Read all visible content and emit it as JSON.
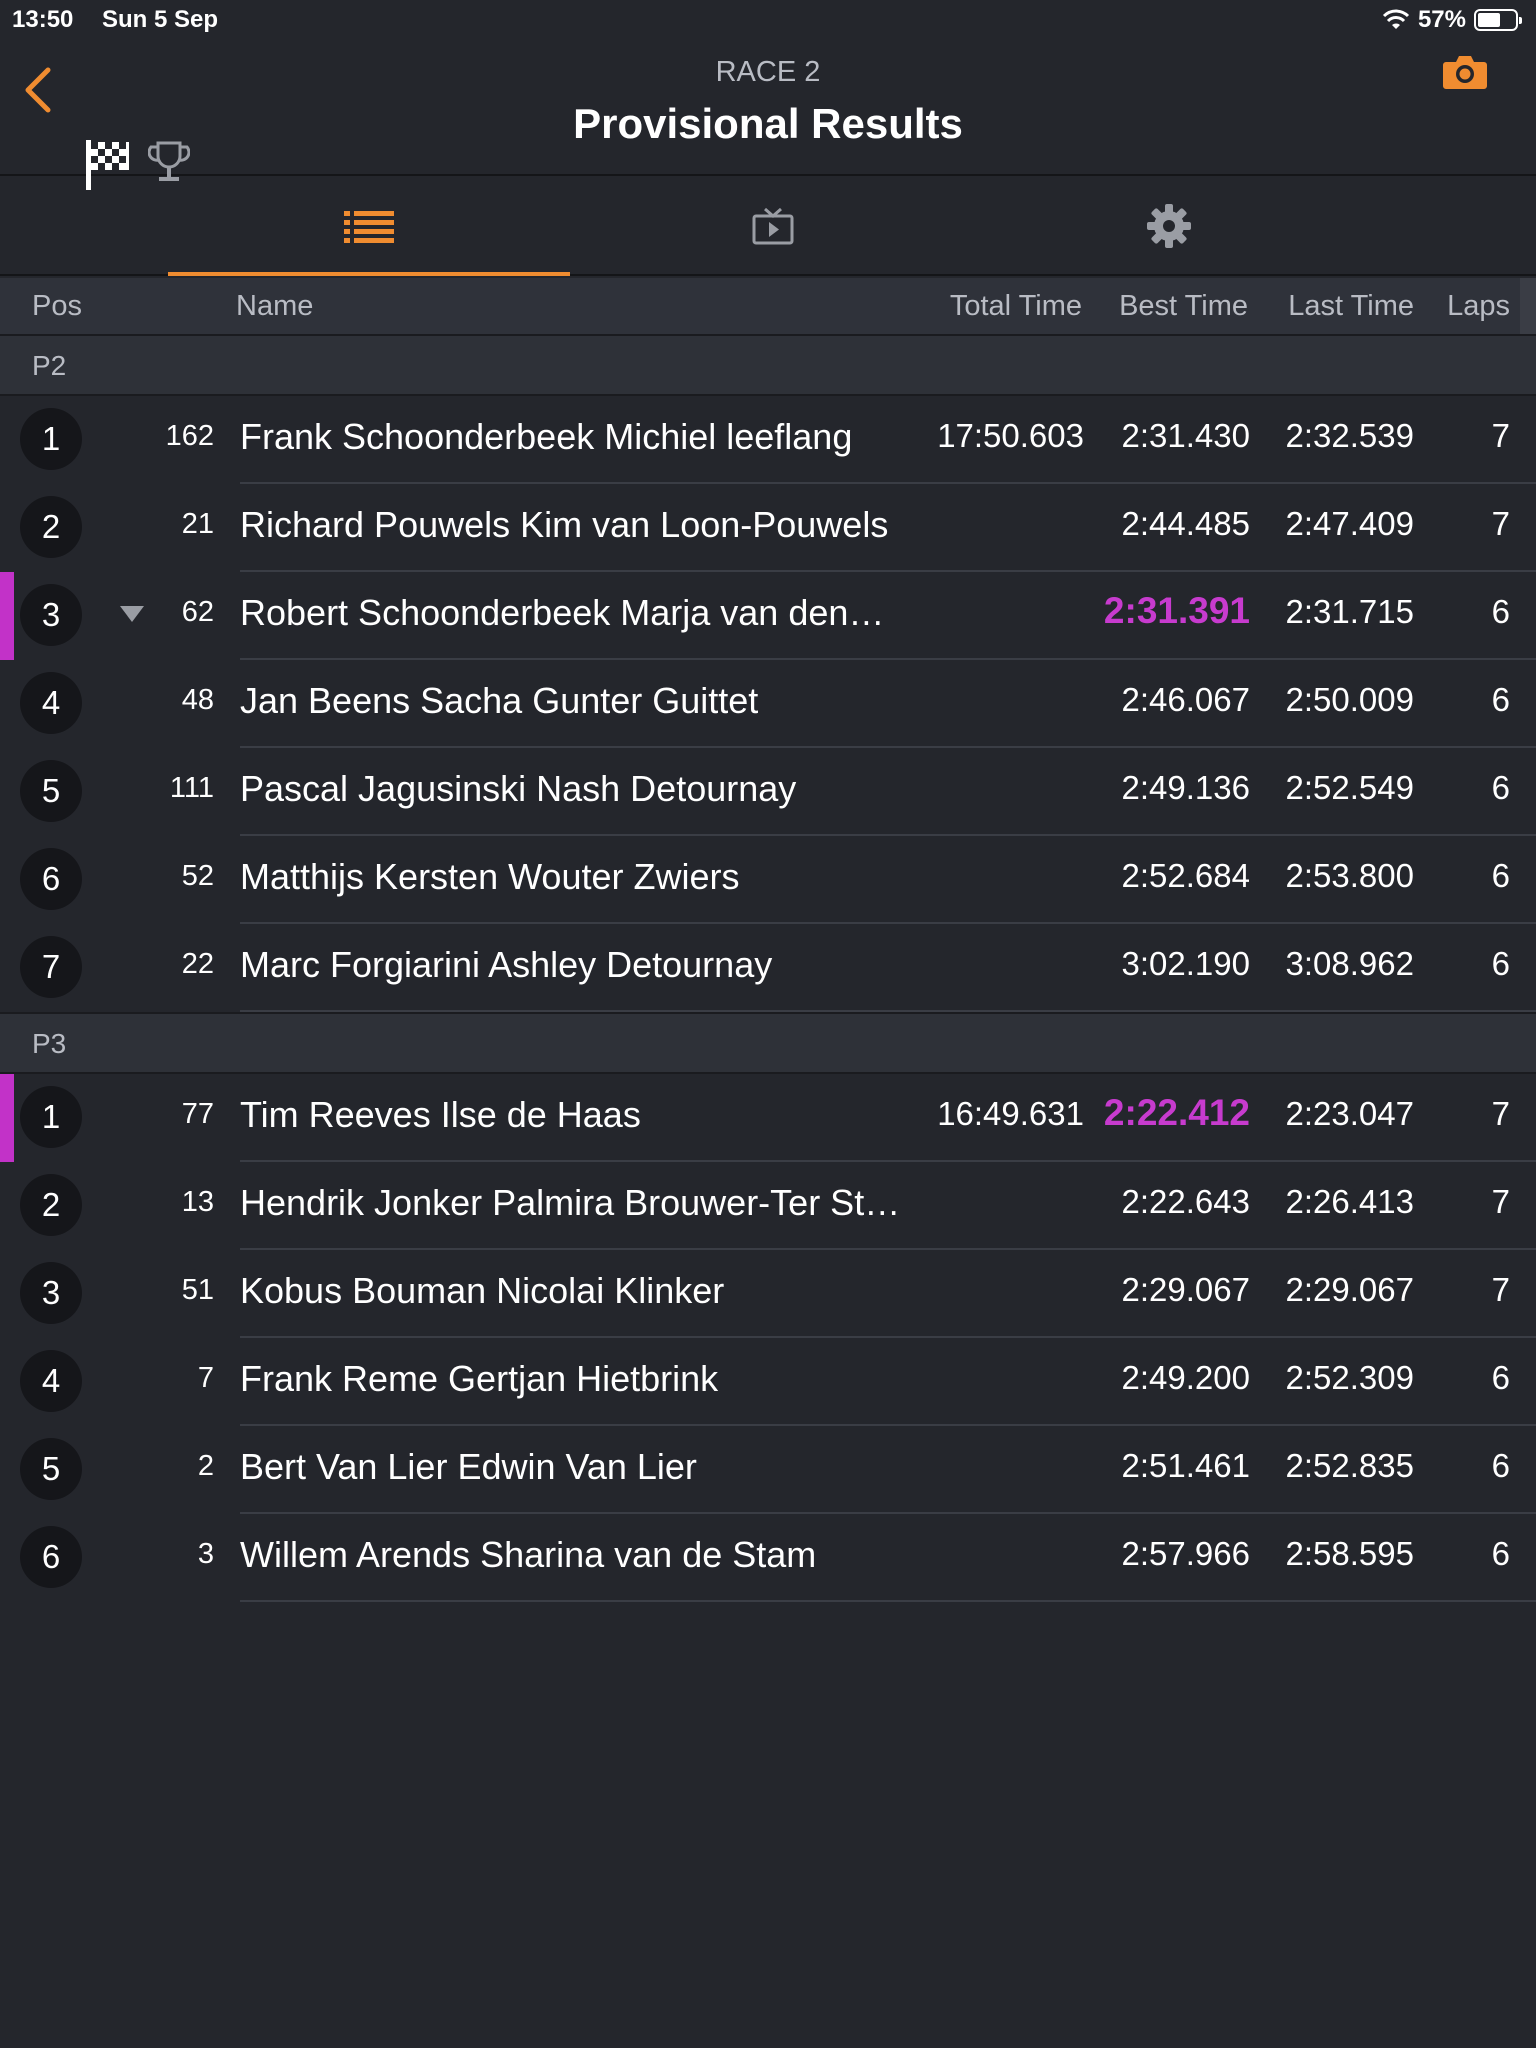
{
  "status_bar": {
    "time": "13:50",
    "date": "Sun 5 Sep",
    "battery": "57%"
  },
  "header": {
    "race_label": "RACE 2",
    "title": "Provisional Results"
  },
  "columns": {
    "pos": "Pos",
    "name": "Name",
    "total_time": "Total Time",
    "best_time": "Best Time",
    "last_time": "Last Time",
    "laps": "Laps"
  },
  "colors": {
    "accent": "#f08c30",
    "fastest": "#c73bce",
    "background": "#24262c"
  },
  "sections": [
    {
      "label": "P2",
      "rows": [
        {
          "pos": "1",
          "car": "162",
          "name": "Frank Schoonderbeek Michiel leeflang",
          "total": "17:50.603",
          "best": "2:31.430",
          "last": "2:32.539",
          "laps": "7",
          "fastest": false,
          "marker": false,
          "trend": false
        },
        {
          "pos": "2",
          "car": "21",
          "name": "Richard Pouwels Kim van Loon-Pouwels",
          "total": "",
          "best": "2:44.485",
          "last": "2:47.409",
          "laps": "7",
          "fastest": false,
          "marker": false,
          "trend": false
        },
        {
          "pos": "3",
          "car": "62",
          "name": "Robert Schoonderbeek Marja van den…",
          "total": "",
          "best": "2:31.391",
          "last": "2:31.715",
          "laps": "6",
          "fastest": true,
          "marker": true,
          "trend": true
        },
        {
          "pos": "4",
          "car": "48",
          "name": "Jan Beens Sacha Gunter Guittet",
          "total": "",
          "best": "2:46.067",
          "last": "2:50.009",
          "laps": "6",
          "fastest": false,
          "marker": false,
          "trend": false
        },
        {
          "pos": "5",
          "car": "111",
          "name": "Pascal Jagusinski Nash Detournay",
          "total": "",
          "best": "2:49.136",
          "last": "2:52.549",
          "laps": "6",
          "fastest": false,
          "marker": false,
          "trend": false
        },
        {
          "pos": "6",
          "car": "52",
          "name": "Matthijs Kersten Wouter Zwiers",
          "total": "",
          "best": "2:52.684",
          "last": "2:53.800",
          "laps": "6",
          "fastest": false,
          "marker": false,
          "trend": false
        },
        {
          "pos": "7",
          "car": "22",
          "name": "Marc Forgiarini Ashley Detournay",
          "total": "",
          "best": "3:02.190",
          "last": "3:08.962",
          "laps": "6",
          "fastest": false,
          "marker": false,
          "trend": false
        }
      ]
    },
    {
      "label": "P3",
      "rows": [
        {
          "pos": "1",
          "car": "77",
          "name": "Tim Reeves Ilse de Haas",
          "total": "16:49.631",
          "best": "2:22.412",
          "last": "2:23.047",
          "laps": "7",
          "fastest": true,
          "marker": true,
          "trend": false
        },
        {
          "pos": "2",
          "car": "13",
          "name": "Hendrik Jonker Palmira Brouwer-Ter St…",
          "total": "",
          "best": "2:22.643",
          "last": "2:26.413",
          "laps": "7",
          "fastest": false,
          "marker": false,
          "trend": false
        },
        {
          "pos": "3",
          "car": "51",
          "name": "Kobus Bouman Nicolai Klinker",
          "total": "",
          "best": "2:29.067",
          "last": "2:29.067",
          "laps": "7",
          "fastest": false,
          "marker": false,
          "trend": false
        },
        {
          "pos": "4",
          "car": "7",
          "name": "Frank Reme Gertjan Hietbrink",
          "total": "",
          "best": "2:49.200",
          "last": "2:52.309",
          "laps": "6",
          "fastest": false,
          "marker": false,
          "trend": false
        },
        {
          "pos": "5",
          "car": "2",
          "name": "Bert Van Lier Edwin Van Lier",
          "total": "",
          "best": "2:51.461",
          "last": "2:52.835",
          "laps": "6",
          "fastest": false,
          "marker": false,
          "trend": false
        },
        {
          "pos": "6",
          "car": "3",
          "name": "Willem Arends Sharina van de Stam",
          "total": "",
          "best": "2:57.966",
          "last": "2:58.595",
          "laps": "6",
          "fastest": false,
          "marker": false,
          "trend": false
        }
      ]
    }
  ]
}
